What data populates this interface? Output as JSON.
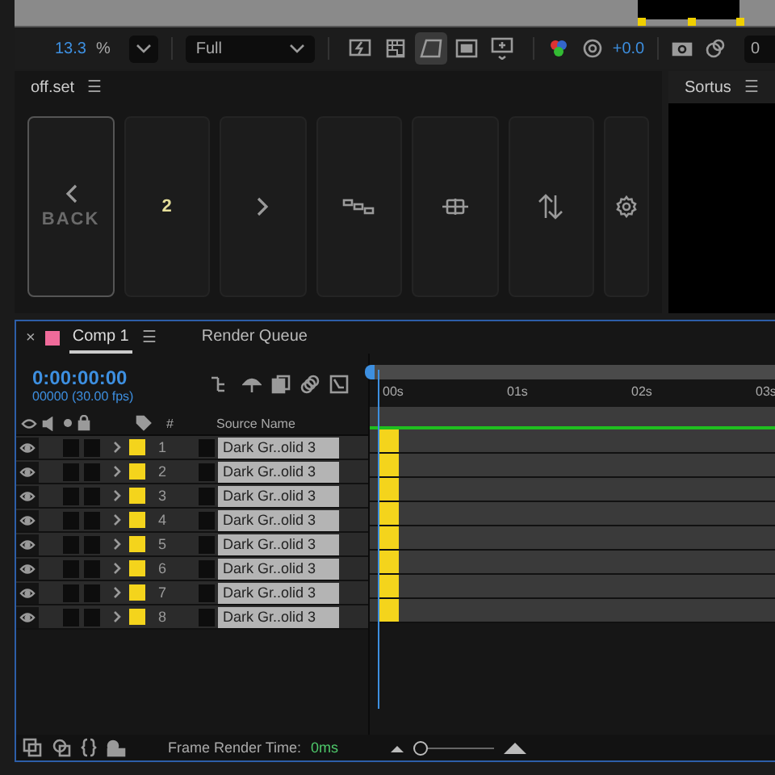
{
  "toolbar": {
    "zoom": "13.3",
    "zoom_unit": "%",
    "resolution": "Full",
    "view_toggles": [
      {
        "kind": "preview",
        "on": false
      },
      {
        "kind": "transparency",
        "on": false
      },
      {
        "kind": "mask",
        "on": true
      },
      {
        "kind": "region",
        "on": false
      },
      {
        "kind": "guides",
        "on": false
      }
    ],
    "exposure": "+0.0",
    "field": "0"
  },
  "offset_panel": {
    "title": "off.set",
    "menu": "☰",
    "buttons": [
      {
        "kind": "back",
        "label": "BACK",
        "selected": true
      },
      {
        "kind": "text",
        "label": "2",
        "selected": false
      },
      {
        "kind": "next",
        "selected": false
      },
      {
        "kind": "chain",
        "selected": false
      },
      {
        "kind": "align",
        "selected": false
      },
      {
        "kind": "swap",
        "selected": false
      },
      {
        "kind": "settings",
        "selected": false
      }
    ]
  },
  "sortus_panel": {
    "title": "Sortus",
    "menu": "☰"
  },
  "timeline": {
    "tabs": [
      {
        "label": "Comp 1",
        "selected": true,
        "color": "#f06b9a",
        "close": "×",
        "menu": "☰"
      },
      {
        "label": "Render Queue",
        "selected": false
      }
    ],
    "timecode": "0:00:00:00",
    "frame_info": "00000 (30.00 fps)",
    "columns": {
      "number": "#",
      "source": "Source Name"
    },
    "ruler": [
      "00s",
      "01s",
      "02s",
      "03s"
    ],
    "layers": [
      {
        "number": "1",
        "name": "Dark Gr..olid 3",
        "visible": true,
        "color": "#f4d41c"
      },
      {
        "number": "2",
        "name": "Dark Gr..olid 3",
        "visible": true,
        "color": "#f4d41c"
      },
      {
        "number": "3",
        "name": "Dark Gr..olid 3",
        "visible": true,
        "color": "#f4d41c"
      },
      {
        "number": "4",
        "name": "Dark Gr..olid 3",
        "visible": true,
        "color": "#f4d41c"
      },
      {
        "number": "5",
        "name": "Dark Gr..olid 3",
        "visible": true,
        "color": "#f4d41c"
      },
      {
        "number": "6",
        "name": "Dark Gr..olid 3",
        "visible": true,
        "color": "#f4d41c"
      },
      {
        "number": "7",
        "name": "Dark Gr..olid 3",
        "visible": true,
        "color": "#f4d41c"
      },
      {
        "number": "8",
        "name": "Dark Gr..olid 3",
        "visible": true,
        "color": "#f4d41c"
      }
    ],
    "status": {
      "label": "Frame Render Time:",
      "value": "0ms"
    },
    "zoom_slider": {
      "level": 0
    }
  }
}
